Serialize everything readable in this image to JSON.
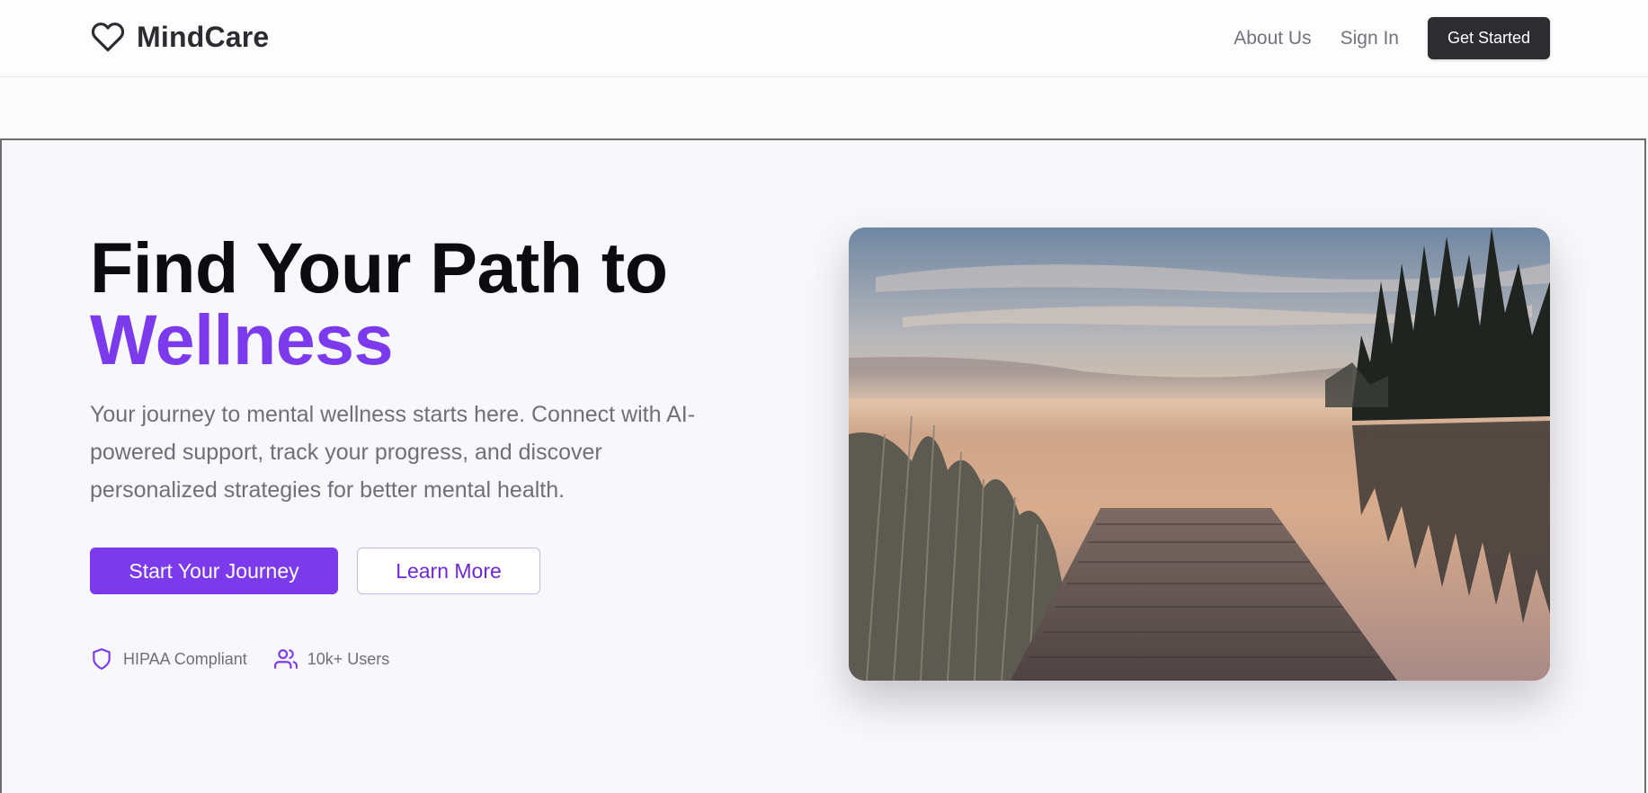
{
  "header": {
    "brand": "MindCare",
    "nav": [
      "About Us",
      "Sign In"
    ],
    "cta": "Get Started"
  },
  "hero": {
    "title_line1": "Find Your Path to",
    "title_accent": "Wellness",
    "description": "Your journey to mental wellness starts here. Connect with AI-powered support, track your progress, and discover personalized strategies for better mental health.",
    "primary_button": "Start Your Journey",
    "secondary_button": "Learn More",
    "badges": [
      {
        "label": "HIPAA Compliant",
        "icon": "shield-icon"
      },
      {
        "label": "10k+ Users",
        "icon": "users-icon"
      }
    ],
    "image": {
      "subject": "misty lake with wooden pier at sunrise"
    }
  },
  "colors": {
    "accent": "#7c3aed",
    "dark_button": "#2c2c31",
    "text_muted": "#6f6f79"
  }
}
